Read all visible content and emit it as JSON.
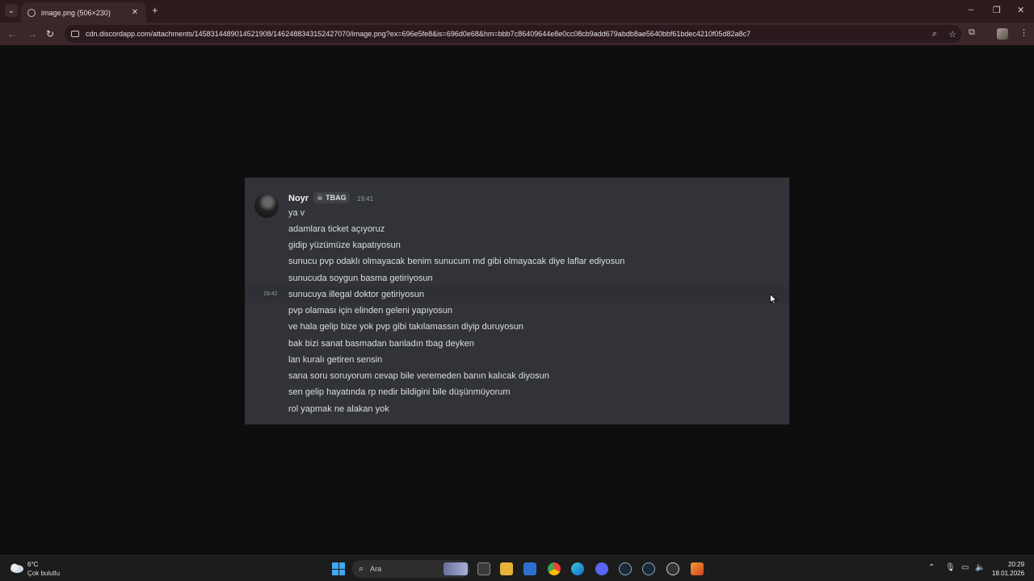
{
  "browser": {
    "tab_title": "image.png (506×230)",
    "new_tab": "+",
    "url": "cdn.discordapp.com/attachments/1458314489014521908/1462488343152427070/image.png?ex=696e5fe8&is=696d0e68&hm=bbb7c86409644e8e0cc08cb9add679abdb8ae5640bbf61bdec4210f05d82a8c7",
    "controls": {
      "minimize": "–",
      "restore": "❐",
      "close": "✕"
    }
  },
  "message": {
    "username": "Noyr",
    "tag": "TBAG",
    "timestamp": "19:41",
    "hover_timestamp": "19:42",
    "lines": [
      "ya v",
      "adamlara ticket açıyoruz",
      "gidip yüzümüze kapatıyosun",
      "sunucu pvp odaklı olmayacak benim sunucum md gibi olmayacak diye laflar ediyosun",
      "sunucuda soygun basma getiriyosun",
      "sunucuya illegal doktor getiriyosun",
      "pvp olaması için elinden geleni yapıyosun",
      "ve hala gelip bize yok pvp gibi takılamassın diyip duruyosun",
      "bak bizi sanat basmadan banladın tbag deyken",
      "lan kuralı getiren sensin",
      "sana soru soruyorum cevap bile veremeden banın kalıcak diyosun",
      "sen gelip hayatında rp nedir bildigini bile düşünmüyorum",
      "rol yapmak ne alakan yok"
    ]
  },
  "taskbar": {
    "temperature": "6°C",
    "weather": "Çok bulutlu",
    "search_placeholder": "Ara",
    "time": "20:29",
    "date": "18.01.2026"
  }
}
